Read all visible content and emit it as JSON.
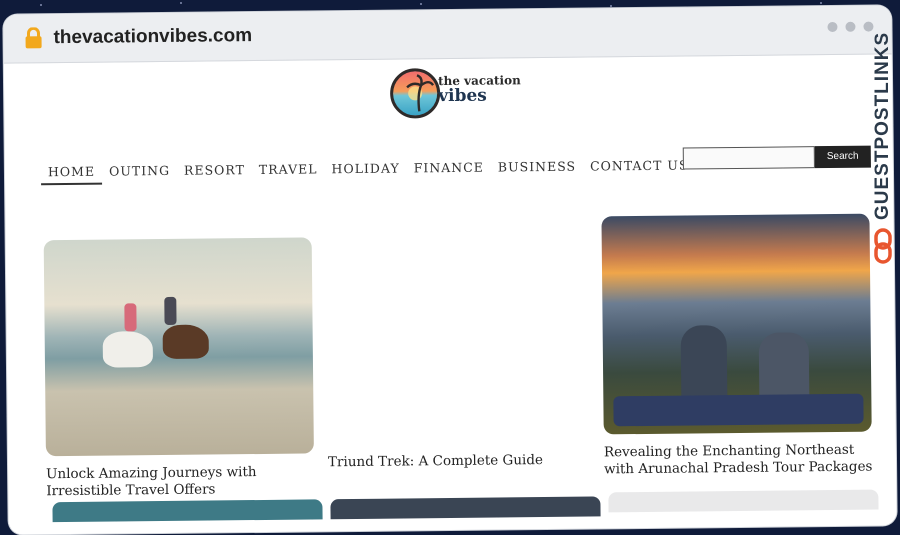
{
  "browser": {
    "url": "thevacationvibes.com",
    "lock_icon": "lock-icon"
  },
  "logo": {
    "line1": "the vacation",
    "line2": "vibes"
  },
  "nav": {
    "items": [
      "HOME",
      "OUTING",
      "RESORT",
      "TRAVEL",
      "HOLIDAY",
      "FINANCE",
      "BUSINESS",
      "CONTACT US"
    ]
  },
  "search": {
    "button": "Search",
    "placeholder": ""
  },
  "cards": [
    {
      "title": "Unlock Amazing Journeys with Irresistible Travel Offers"
    },
    {
      "title": "Triund Trek: A Complete Guide"
    },
    {
      "title": "Revealing the Enchanting Northeast with Arunachal Pradesh Tour Packages"
    }
  ],
  "watermark": {
    "text": "GUESTPOSTLINKS",
    "color": "#e8562f"
  }
}
